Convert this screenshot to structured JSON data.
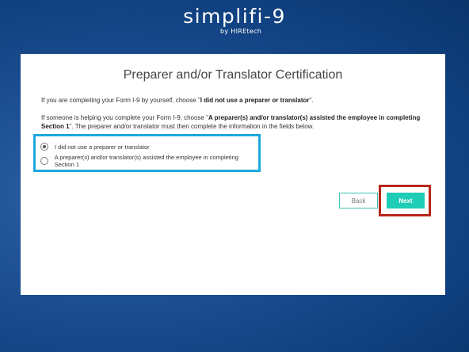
{
  "brand": {
    "logo": "simplifi-9",
    "sub": "by HIREtech"
  },
  "card": {
    "title": "Preparer and/or Translator Certification",
    "p1_prefix": "If you are completing your Form I-9 by yourself, choose \"",
    "p1_bold": "I did not use a preparer or translator",
    "p1_suffix": "\".",
    "p2_prefix": "If someone is helping you complete your Form I-9, choose \"",
    "p2_bold": "A preparer(s) and/or translator(s) assisted the employee in completing Section 1",
    "p2_suffix": "\". The preparer and/or translator must then complete the information in the fields below."
  },
  "options": [
    {
      "label": "I did not use a preparer or translator",
      "checked": true
    },
    {
      "label": "A preparer(s) and/or translator(s) assisted the employee in completing Section 1",
      "checked": false
    }
  ],
  "buttons": {
    "back": "Back",
    "next": "Next"
  },
  "colors": {
    "background": "#1c4e92",
    "highlight_blue": "#1fa8de",
    "highlight_red": "#b8281c",
    "accent_teal": "#1ecdb6"
  }
}
